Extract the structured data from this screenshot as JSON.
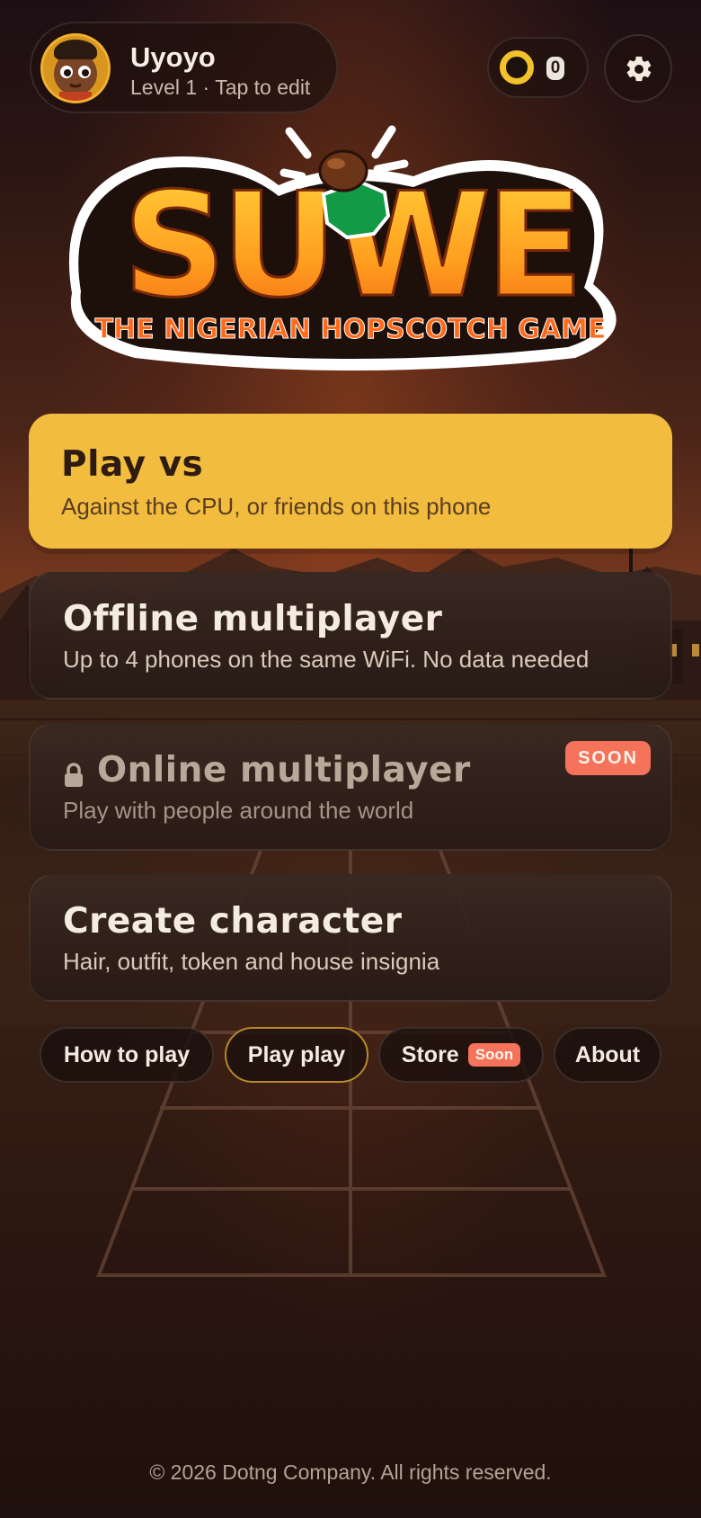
{
  "profile": {
    "name": "Uyoyo",
    "subtitle": "Level 1 · Tap to edit"
  },
  "wallet": {
    "coins": "0",
    "coin_icon": "coin-icon"
  },
  "settings": {
    "icon": "gear-icon"
  },
  "logo": {
    "title": "SUWE",
    "tagline": "THE NIGERIAN HOPSCOTCH GAME"
  },
  "menu": [
    {
      "title": "Play vs",
      "subtitle": "Against the CPU, or friends on this phone"
    },
    {
      "title": "Offline multiplayer",
      "subtitle": "Up to 4 phones on the same WiFi. No data needed"
    },
    {
      "title": "Online multiplayer",
      "subtitle": "Play with people around the world",
      "badge": "SOON",
      "locked": true
    },
    {
      "title": "Create character",
      "subtitle": "Hair, outfit, token and house insignia"
    }
  ],
  "chips": [
    {
      "label": "How to play"
    },
    {
      "label": "Play play",
      "active": true
    },
    {
      "label": "Store",
      "badge": "Soon"
    },
    {
      "label": "About"
    }
  ],
  "colors": {
    "primary_card": "#f2bc3e",
    "soon_badge": "#f5735a",
    "background": "#23120c"
  },
  "footer": "© 2026 Dotng Company. All rights reserved."
}
